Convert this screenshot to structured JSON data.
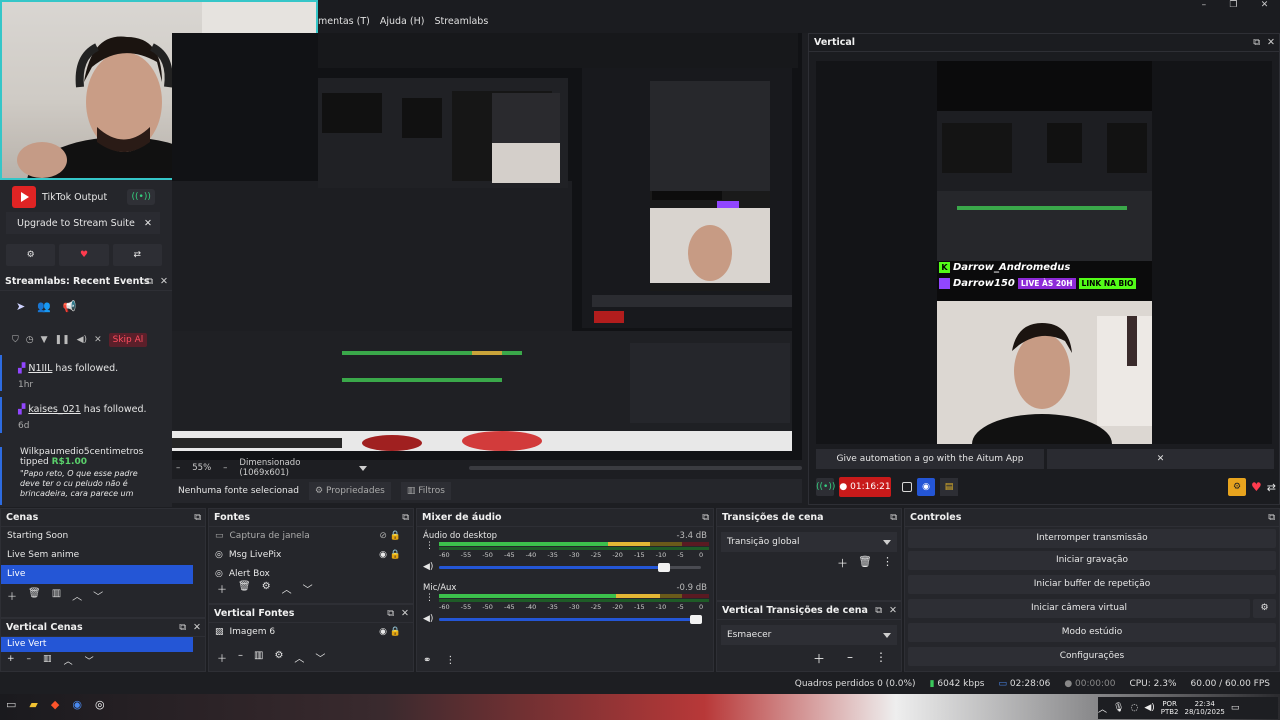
{
  "menu": {
    "items": [
      "mentas (T)",
      "Ajuda (H)",
      "Streamlabs"
    ]
  },
  "window_controls": {
    "min": "–",
    "max": "❐",
    "close": "✕"
  },
  "tiktok": {
    "label": "TikTok Output",
    "upgrade": "Upgrade to Stream Suite"
  },
  "recent_events": {
    "title": "Streamlabs: Recent Events",
    "skip": "Skip Al",
    "events": [
      {
        "user": "N1IIL",
        "action": "has followed.",
        "time": "1hr"
      },
      {
        "user": "kaises_021",
        "action": "has followed.",
        "time": "6d"
      }
    ],
    "tip": {
      "user": "Wilkpaumedio5centimetros",
      "action": "tipped",
      "amount": "R$1.00",
      "message": "\"Papo reto, O que esse padre deve ter o cu peludo não é brincadeira, cara parece um"
    }
  },
  "preview": {
    "zoom": "55%",
    "dims": "Dimensionado (1069x601)"
  },
  "source_bar": {
    "none": "Nenhuma fonte selecionad",
    "props": "Propriedades",
    "filters": "Filtros"
  },
  "vertical": {
    "title": "Vertical",
    "overlay": {
      "name1": "Darrow_Andromedus",
      "name2": "Darrow150",
      "live": "LIVE ÀS 20H",
      "link": "LINK NA BIO"
    },
    "banner": "Give automation a go with the Aitum App",
    "timer": "01:16:21"
  },
  "scenes": {
    "title": "Cenas",
    "items": [
      "Starting Soon",
      "Live Sem anime",
      "Live"
    ],
    "selected": 2
  },
  "sources": {
    "title": "Fontes",
    "items": [
      "Captura de janela",
      "Msg LivePix",
      "Alert Box"
    ]
  },
  "mixer": {
    "title": "Mixer de áudio",
    "channels": [
      {
        "name": "Áudio do desktop",
        "db": "-3.4 dB",
        "level": 0.78,
        "volume": 0.86
      },
      {
        "name": "Mic/Aux",
        "db": "-0.9 dB",
        "level": 0.82,
        "volume": 0.98
      }
    ],
    "ticks": [
      "-60",
      "-55",
      "-50",
      "-45",
      "-40",
      "-35",
      "-30",
      "-25",
      "-20",
      "-15",
      "-10",
      "-5",
      "0"
    ]
  },
  "transitions": {
    "title": "Transições de cena",
    "value": "Transição global"
  },
  "vtransitions": {
    "title": "Vertical Transições de cena",
    "value": "Esmaecer"
  },
  "controls": {
    "title": "Controles",
    "buttons": [
      "Interromper transmissão",
      "Iniciar gravação",
      "Iniciar buffer de repetição",
      "Iniciar câmera virtual",
      "Modo estúdio",
      "Configurações"
    ]
  },
  "vscenes": {
    "title": "Vertical Cenas",
    "items": [
      "Live Vert"
    ]
  },
  "vsources": {
    "title": "Vertical Fontes",
    "items": [
      "Imagem 6"
    ]
  },
  "status": {
    "dropped": "Quadros perdidos 0 (0.0%)",
    "bitrate": "6042 kbps",
    "stream_time": "02:28:06",
    "rec_time": "00:00:00",
    "cpu": "CPU: 2.3%",
    "fps": "60.00 / 60.00 FPS"
  },
  "taskbar": {
    "lang": "POR",
    "lang2": "PTB2",
    "time": "22:34",
    "date": "28/10/2025"
  },
  "colors": {
    "accent": "#2456d6",
    "live": "#d01818",
    "kick": "#53fc18",
    "purple": "#9146ff"
  }
}
